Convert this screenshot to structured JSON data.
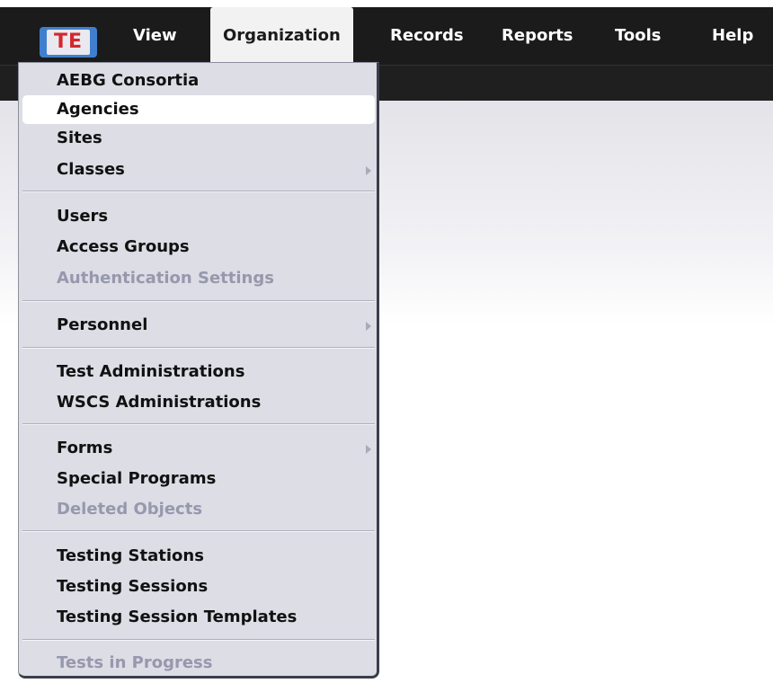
{
  "menubar": {
    "logo": "TE",
    "items": [
      "View",
      "Organization",
      "Records",
      "Reports",
      "Tools",
      "Help"
    ],
    "active_item": "Organization"
  },
  "dropdown": {
    "items": [
      {
        "label": "AEBG Consortia",
        "enabled": true
      },
      {
        "label": "Agencies",
        "enabled": true,
        "highlighted": true
      },
      {
        "label": "Sites",
        "enabled": true
      },
      {
        "label": "Classes",
        "enabled": true,
        "submenu": true
      },
      {
        "label": "Users",
        "enabled": true
      },
      {
        "label": "Access Groups",
        "enabled": true
      },
      {
        "label": "Authentication Settings",
        "enabled": false
      },
      {
        "label": "Personnel",
        "enabled": true,
        "submenu": true
      },
      {
        "label": "Test Administrations",
        "enabled": true
      },
      {
        "label": "WSCS Administrations",
        "enabled": true
      },
      {
        "label": "Forms",
        "enabled": true,
        "submenu": true
      },
      {
        "label": "Special Programs",
        "enabled": true
      },
      {
        "label": "Deleted Objects",
        "enabled": false
      },
      {
        "label": "Testing Stations",
        "enabled": true
      },
      {
        "label": "Testing Sessions",
        "enabled": true
      },
      {
        "label": "Testing Session Templates",
        "enabled": true
      },
      {
        "label": "Tests in Progress",
        "enabled": false
      }
    ]
  },
  "colors": {
    "menubar_bg": "#1b1b1b",
    "logo_blue": "#3f7fce",
    "logo_red": "#d3272f",
    "dropdown_bg": "#dcdde5",
    "disabled_text": "#9698ad"
  }
}
